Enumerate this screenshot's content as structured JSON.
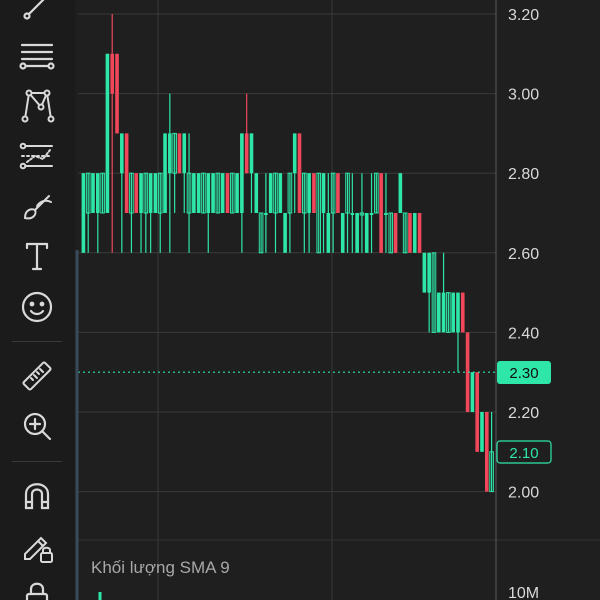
{
  "toolbar": {
    "tools": [
      {
        "name": "trend-line-icon"
      },
      {
        "name": "fib-lines-icon"
      },
      {
        "name": "pattern-icon"
      },
      {
        "name": "forecast-icon"
      },
      {
        "name": "brush-icon"
      },
      {
        "name": "text-tool-icon"
      },
      {
        "name": "emoji-icon"
      },
      {
        "name": "ruler-icon"
      },
      {
        "name": "zoom-in-icon"
      },
      {
        "name": "magnet-icon"
      },
      {
        "name": "lock-drawing-icon"
      },
      {
        "name": "lock-icon"
      }
    ]
  },
  "price_axis": {
    "ticks": [
      "3.20",
      "3.00",
      "2.80",
      "2.60",
      "2.40",
      "2.20",
      "2.00"
    ],
    "current_price": "2.10",
    "reference_price": "2.30"
  },
  "volume": {
    "legend": "Khối lượng SMA 9",
    "axis_label": "10M"
  },
  "colors": {
    "up": "#2ee6a8",
    "down": "#f0475a",
    "background": "#1f1f1f",
    "grid": "#3a3a3a",
    "axis_text": "#d9d9d9",
    "reference_line": "#2ee6a8"
  },
  "chart_data": {
    "type": "candlestick",
    "ylim": [
      1.95,
      3.24
    ],
    "candles": [
      {
        "o": 2.8,
        "h": 2.8,
        "l": 2.6,
        "c": 2.6,
        "dir": "up"
      },
      {
        "o": 2.7,
        "h": 2.8,
        "l": 2.6,
        "c": 2.8,
        "dir": "up"
      },
      {
        "o": 2.7,
        "h": 2.8,
        "l": 2.7,
        "c": 2.8,
        "dir": "up"
      },
      {
        "o": 2.7,
        "h": 2.8,
        "l": 2.6,
        "c": 2.8,
        "dir": "up"
      },
      {
        "o": 2.7,
        "h": 2.8,
        "l": 2.7,
        "c": 2.8,
        "dir": "up"
      },
      {
        "o": 2.7,
        "h": 3.1,
        "l": 2.7,
        "c": 3.1,
        "dir": "up"
      },
      {
        "o": 3.1,
        "h": 3.2,
        "l": 2.6,
        "c": 3.0,
        "dir": "down"
      },
      {
        "o": 3.1,
        "h": 3.1,
        "l": 2.9,
        "c": 2.9,
        "dir": "down"
      },
      {
        "o": 2.8,
        "h": 2.9,
        "l": 2.6,
        "c": 2.9,
        "dir": "up"
      },
      {
        "o": 2.9,
        "h": 2.9,
        "l": 2.7,
        "c": 2.7,
        "dir": "down"
      },
      {
        "o": 2.7,
        "h": 2.8,
        "l": 2.6,
        "c": 2.8,
        "dir": "up"
      },
      {
        "o": 2.8,
        "h": 2.8,
        "l": 2.7,
        "c": 2.7,
        "dir": "down"
      },
      {
        "o": 2.7,
        "h": 2.8,
        "l": 2.6,
        "c": 2.8,
        "dir": "up"
      },
      {
        "o": 2.7,
        "h": 2.8,
        "l": 2.6,
        "c": 2.8,
        "dir": "up"
      },
      {
        "o": 2.8,
        "h": 2.8,
        "l": 2.6,
        "c": 2.7,
        "dir": "up"
      },
      {
        "o": 2.7,
        "h": 2.8,
        "l": 2.7,
        "c": 2.8,
        "dir": "up"
      },
      {
        "o": 2.7,
        "h": 2.8,
        "l": 2.6,
        "c": 2.8,
        "dir": "up"
      },
      {
        "o": 2.7,
        "h": 2.9,
        "l": 2.7,
        "c": 2.9,
        "dir": "up"
      },
      {
        "o": 2.8,
        "h": 3.0,
        "l": 2.6,
        "c": 2.9,
        "dir": "up"
      },
      {
        "o": 2.8,
        "h": 2.9,
        "l": 2.7,
        "c": 2.9,
        "dir": "up"
      },
      {
        "o": 2.9,
        "h": 2.9,
        "l": 2.8,
        "c": 2.8,
        "dir": "down"
      },
      {
        "o": 2.8,
        "h": 2.9,
        "l": 2.7,
        "c": 2.9,
        "dir": "up"
      },
      {
        "o": 2.7,
        "h": 2.9,
        "l": 2.6,
        "c": 2.8,
        "dir": "up"
      },
      {
        "o": 2.8,
        "h": 2.8,
        "l": 2.7,
        "c": 2.7,
        "dir": "up"
      },
      {
        "o": 2.8,
        "h": 2.8,
        "l": 2.7,
        "c": 2.7,
        "dir": "up"
      },
      {
        "o": 2.7,
        "h": 2.8,
        "l": 2.7,
        "c": 2.8,
        "dir": "up"
      },
      {
        "o": 2.7,
        "h": 2.8,
        "l": 2.6,
        "c": 2.8,
        "dir": "up"
      },
      {
        "o": 2.8,
        "h": 2.8,
        "l": 2.7,
        "c": 2.7,
        "dir": "up"
      },
      {
        "o": 2.8,
        "h": 2.8,
        "l": 2.7,
        "c": 2.7,
        "dir": "up"
      },
      {
        "o": 2.8,
        "h": 2.8,
        "l": 2.7,
        "c": 2.7,
        "dir": "up"
      },
      {
        "o": 2.8,
        "h": 2.8,
        "l": 2.7,
        "c": 2.7,
        "dir": "down"
      },
      {
        "o": 2.7,
        "h": 2.8,
        "l": 2.7,
        "c": 2.8,
        "dir": "up"
      },
      {
        "o": 2.8,
        "h": 2.8,
        "l": 2.7,
        "c": 2.7,
        "dir": "up"
      },
      {
        "o": 2.7,
        "h": 2.9,
        "l": 2.6,
        "c": 2.9,
        "dir": "up"
      },
      {
        "o": 2.9,
        "h": 3.0,
        "l": 2.8,
        "c": 2.8,
        "dir": "down"
      },
      {
        "o": 2.8,
        "h": 2.9,
        "l": 2.7,
        "c": 2.9,
        "dir": "up"
      },
      {
        "o": 2.8,
        "h": 2.8,
        "l": 2.7,
        "c": 2.7,
        "dir": "up"
      },
      {
        "o": 2.6,
        "h": 2.7,
        "l": 2.6,
        "c": 2.7,
        "dir": "up"
      },
      {
        "o": 2.7,
        "h": 2.8,
        "l": 2.6,
        "c": 2.7,
        "dir": "up"
      },
      {
        "o": 2.8,
        "h": 2.8,
        "l": 2.7,
        "c": 2.7,
        "dir": "up"
      },
      {
        "o": 2.7,
        "h": 2.8,
        "l": 2.6,
        "c": 2.8,
        "dir": "up"
      },
      {
        "o": 2.7,
        "h": 2.8,
        "l": 2.7,
        "c": 2.8,
        "dir": "up"
      },
      {
        "o": 2.6,
        "h": 2.7,
        "l": 2.6,
        "c": 2.7,
        "dir": "up"
      },
      {
        "o": 2.7,
        "h": 2.8,
        "l": 2.6,
        "c": 2.8,
        "dir": "up"
      },
      {
        "o": 2.8,
        "h": 2.9,
        "l": 2.7,
        "c": 2.9,
        "dir": "up"
      },
      {
        "o": 2.9,
        "h": 2.9,
        "l": 2.7,
        "c": 2.7,
        "dir": "down"
      },
      {
        "o": 2.7,
        "h": 2.8,
        "l": 2.6,
        "c": 2.8,
        "dir": "up"
      },
      {
        "o": 2.7,
        "h": 2.8,
        "l": 2.6,
        "c": 2.8,
        "dir": "up"
      },
      {
        "o": 2.8,
        "h": 2.8,
        "l": 2.7,
        "c": 2.7,
        "dir": "down"
      },
      {
        "o": 2.6,
        "h": 2.8,
        "l": 2.6,
        "c": 2.8,
        "dir": "up"
      },
      {
        "o": 2.7,
        "h": 2.8,
        "l": 2.6,
        "c": 2.8,
        "dir": "up"
      },
      {
        "o": 2.6,
        "h": 2.8,
        "l": 2.6,
        "c": 2.7,
        "dir": "up"
      },
      {
        "o": 2.7,
        "h": 2.8,
        "l": 2.6,
        "c": 2.8,
        "dir": "up"
      },
      {
        "o": 2.8,
        "h": 2.8,
        "l": 2.7,
        "c": 2.7,
        "dir": "down"
      },
      {
        "o": 2.6,
        "h": 2.7,
        "l": 2.6,
        "c": 2.7,
        "dir": "up"
      },
      {
        "o": 2.7,
        "h": 2.8,
        "l": 2.6,
        "c": 2.8,
        "dir": "up"
      },
      {
        "o": 2.7,
        "h": 2.8,
        "l": 2.6,
        "c": 2.7,
        "dir": "up"
      },
      {
        "o": 2.6,
        "h": 2.7,
        "l": 2.6,
        "c": 2.7,
        "dir": "up"
      },
      {
        "o": 2.7,
        "h": 2.8,
        "l": 2.6,
        "c": 2.7,
        "dir": "up"
      },
      {
        "o": 2.6,
        "h": 2.7,
        "l": 2.6,
        "c": 2.7,
        "dir": "up"
      },
      {
        "o": 2.7,
        "h": 2.8,
        "l": 2.6,
        "c": 2.7,
        "dir": "up"
      },
      {
        "o": 2.7,
        "h": 2.8,
        "l": 2.7,
        "c": 2.8,
        "dir": "up"
      },
      {
        "o": 2.8,
        "h": 2.8,
        "l": 2.6,
        "c": 2.6,
        "dir": "down"
      },
      {
        "o": 2.7,
        "h": 2.8,
        "l": 2.6,
        "c": 2.7,
        "dir": "up"
      },
      {
        "o": 2.6,
        "h": 2.7,
        "l": 2.6,
        "c": 2.7,
        "dir": "up"
      },
      {
        "o": 2.7,
        "h": 2.7,
        "l": 2.6,
        "c": 2.6,
        "dir": "down"
      },
      {
        "o": 2.7,
        "h": 2.8,
        "l": 2.7,
        "c": 2.8,
        "dir": "up"
      },
      {
        "o": 2.6,
        "h": 2.7,
        "l": 2.6,
        "c": 2.7,
        "dir": "up"
      },
      {
        "o": 2.7,
        "h": 2.7,
        "l": 2.6,
        "c": 2.6,
        "dir": "down"
      },
      {
        "o": 2.6,
        "h": 2.7,
        "l": 2.6,
        "c": 2.7,
        "dir": "up"
      },
      {
        "o": 2.7,
        "h": 2.7,
        "l": 2.6,
        "c": 2.6,
        "dir": "down"
      },
      {
        "o": 2.6,
        "h": 2.6,
        "l": 2.5,
        "c": 2.5,
        "dir": "up"
      },
      {
        "o": 2.5,
        "h": 2.6,
        "l": 2.4,
        "c": 2.6,
        "dir": "up"
      },
      {
        "o": 2.6,
        "h": 2.6,
        "l": 2.4,
        "c": 2.4,
        "dir": "up"
      },
      {
        "o": 2.4,
        "h": 2.5,
        "l": 2.4,
        "c": 2.5,
        "dir": "up"
      },
      {
        "o": 2.5,
        "h": 2.6,
        "l": 2.4,
        "c": 2.4,
        "dir": "up"
      },
      {
        "o": 2.4,
        "h": 2.5,
        "l": 2.4,
        "c": 2.5,
        "dir": "up"
      },
      {
        "o": 2.5,
        "h": 2.5,
        "l": 2.4,
        "c": 2.4,
        "dir": "up"
      },
      {
        "o": 2.4,
        "h": 2.5,
        "l": 2.3,
        "c": 2.5,
        "dir": "up"
      },
      {
        "o": 2.5,
        "h": 2.5,
        "l": 2.4,
        "c": 2.4,
        "dir": "down"
      },
      {
        "o": 2.4,
        "h": 2.4,
        "l": 2.2,
        "c": 2.2,
        "dir": "down"
      },
      {
        "o": 2.2,
        "h": 2.3,
        "l": 2.2,
        "c": 2.3,
        "dir": "up"
      },
      {
        "o": 2.3,
        "h": 2.3,
        "l": 2.1,
        "c": 2.1,
        "dir": "down"
      },
      {
        "o": 2.1,
        "h": 2.2,
        "l": 2.1,
        "c": 2.2,
        "dir": "up"
      },
      {
        "o": 2.2,
        "h": 2.2,
        "l": 2.0,
        "c": 2.0,
        "dir": "down"
      },
      {
        "o": 2.0,
        "h": 2.2,
        "l": 2.0,
        "c": 2.1,
        "dir": "up"
      }
    ]
  }
}
